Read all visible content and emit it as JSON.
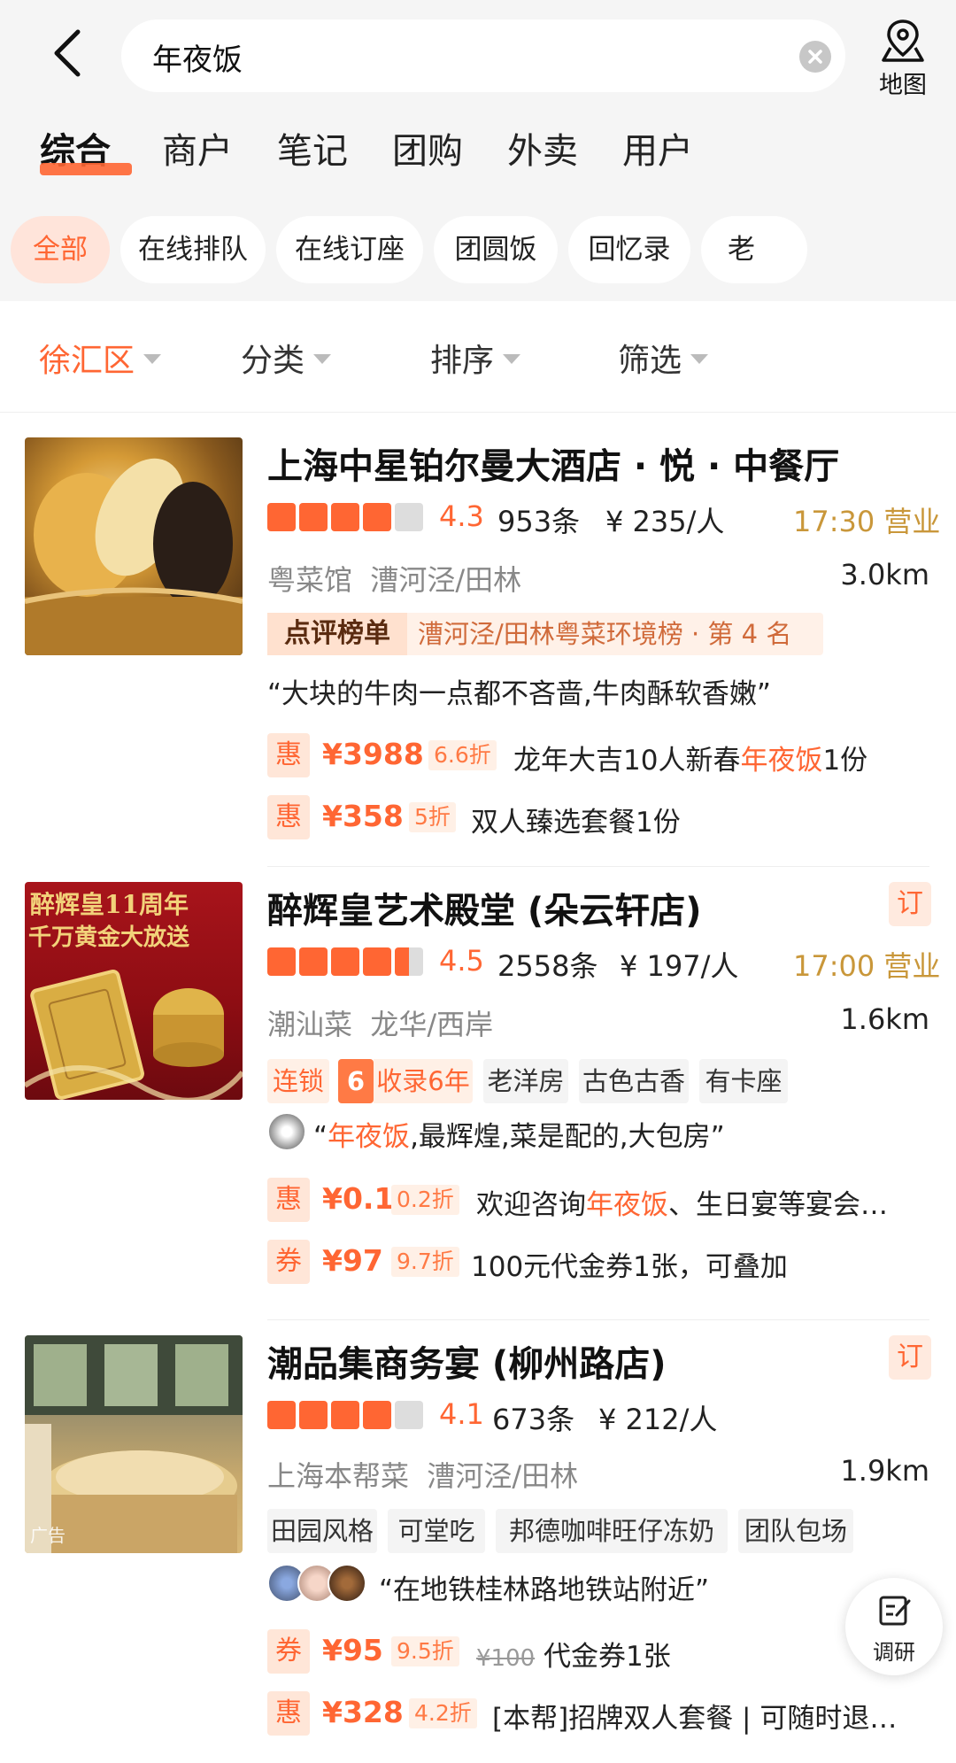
{
  "search": {
    "query": "年夜饭",
    "map_label": "地图"
  },
  "tabs": [
    "综合",
    "商户",
    "笔记",
    "团购",
    "外卖",
    "用户"
  ],
  "chips": [
    "全部",
    "在线排队",
    "在线订座",
    "团圆饭",
    "回忆录",
    "老"
  ],
  "filters": [
    "徐汇区",
    "分类",
    "排序",
    "筛选"
  ],
  "colors": {
    "accent": "#ff6633",
    "gold": "#c9973a"
  },
  "listings": [
    {
      "title": "上海中星铂尔曼大酒店 · 悦 · 中餐厅",
      "rating": "4.3",
      "stars": 4,
      "reviews": "953条",
      "price": "¥ 235/人",
      "hours": "17:30 营业",
      "cuisine": "粤菜馆",
      "area": "漕河泾/田林",
      "distance": "3.0km",
      "rank_label": "点评榜单",
      "rank_text": "漕河泾/田林粤菜环境榜 · 第 4 名",
      "quote": "“大块的牛肉一点都不吝啬,牛肉酥软香嫩”",
      "deals": [
        {
          "badge": "惠",
          "price": "¥3988",
          "discount": "6.6折",
          "text_a": "龙年大吉10人新春",
          "text_hl": "年夜饭",
          "text_b": "1份"
        },
        {
          "badge": "惠",
          "price": "¥358",
          "discount": "5折",
          "text_a": "双人臻选套餐1份",
          "text_hl": "",
          "text_b": ""
        }
      ]
    },
    {
      "title": "醉辉皇艺术殿堂 (朵云轩店)",
      "order_tag": "订",
      "rating": "4.5",
      "stars": 4.5,
      "reviews": "2558条",
      "price": "¥ 197/人",
      "hours": "17:00 营业",
      "cuisine": "潮汕菜",
      "area": "龙华/西岸",
      "distance": "1.6km",
      "thumb_line1": "醉辉皇11周年",
      "thumb_line2": "千万黄金大放送",
      "tags": [
        "连锁",
        "6",
        "收录6年",
        "老洋房",
        "古色古香",
        "有卡座"
      ],
      "quote_a": "“",
      "quote_hl": "年夜饭",
      "quote_b": ",最辉煌,菜是配的,大包房”",
      "deals": [
        {
          "badge": "惠",
          "price": "¥0.1",
          "discount": "0.2折",
          "text_a": "欢迎咨询",
          "text_hl": "年夜饭",
          "text_b": "、生日宴等宴会…"
        },
        {
          "badge": "券",
          "price": "¥97",
          "discount": "9.7折",
          "text_a": "100元代金券1张，可叠加",
          "text_hl": "",
          "text_b": ""
        }
      ]
    },
    {
      "title": "潮品集商务宴 (柳州路店)",
      "order_tag": "订",
      "rating": "4.1",
      "stars": 4,
      "reviews": "673条",
      "price": "¥ 212/人",
      "cuisine": "上海本帮菜",
      "area": "漕河泾/田林",
      "distance": "1.9km",
      "ad_label": "广告",
      "tags": [
        "田园风格",
        "可堂吃",
        "邦德咖啡旺仔冻奶",
        "团队包场"
      ],
      "quote": "“在地铁桂林路地铁站附近”",
      "deals": [
        {
          "badge": "券",
          "price": "¥95",
          "discount": "9.5折",
          "original": "¥100",
          "text_a": "代金券1张",
          "text_hl": "",
          "text_b": ""
        },
        {
          "badge": "惠",
          "price": "¥328",
          "discount": "4.2折",
          "text_a": "[本帮]招牌双人套餐 | 可随时退…",
          "text_hl": "",
          "text_b": ""
        }
      ]
    }
  ],
  "float_button": {
    "label": "调研"
  }
}
